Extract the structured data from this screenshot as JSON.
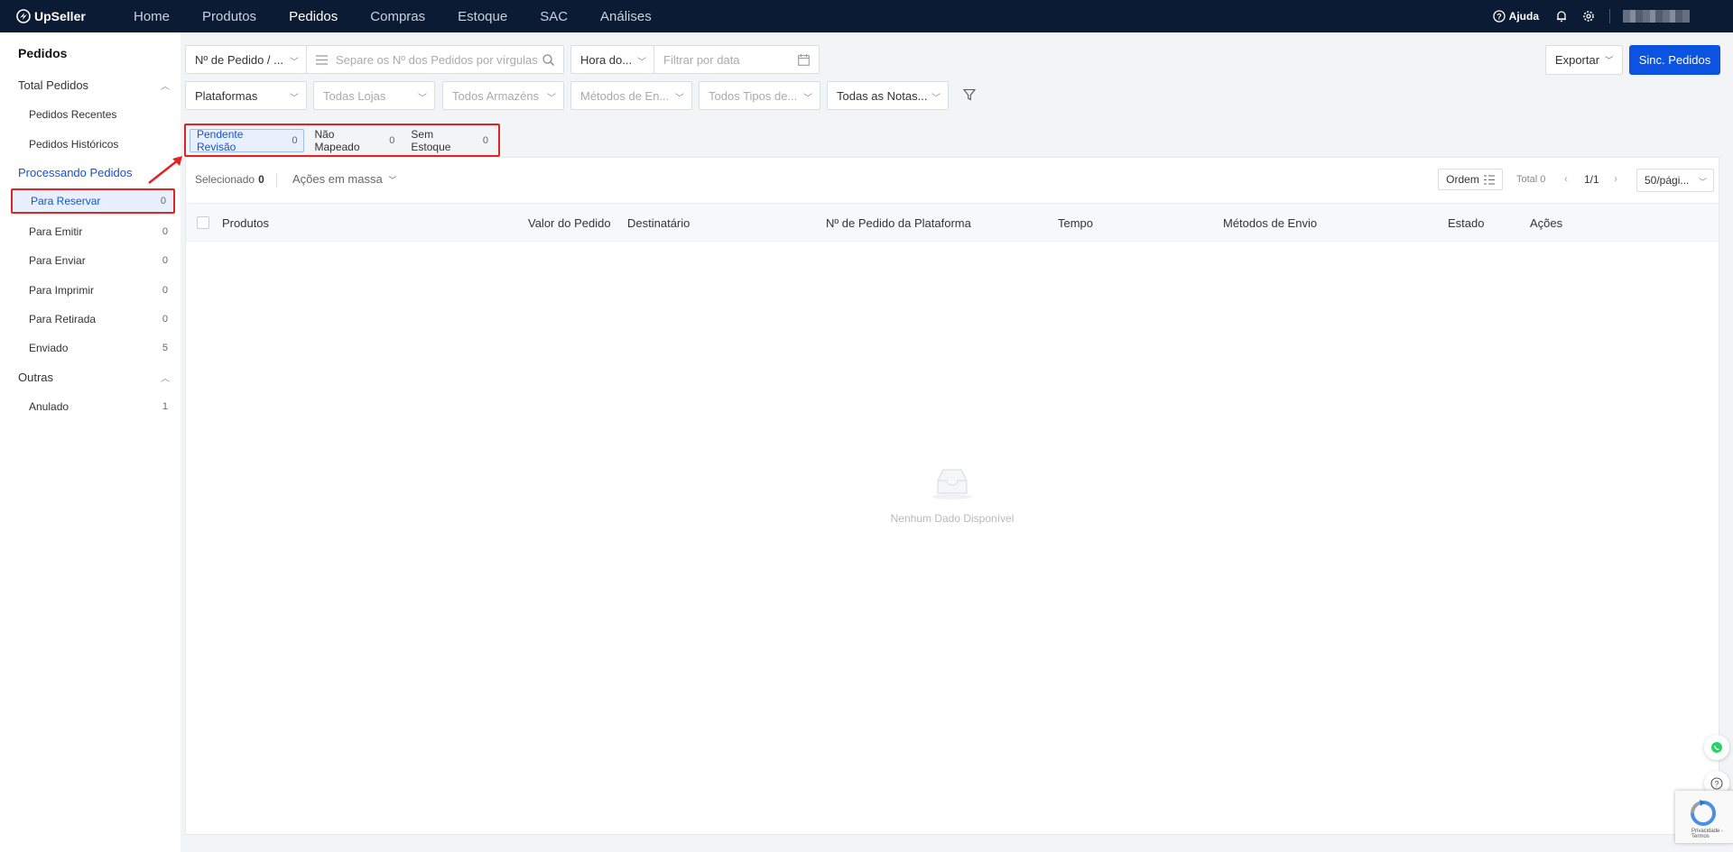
{
  "app": {
    "brand": "UpSeller"
  },
  "nav": {
    "items": [
      "Home",
      "Produtos",
      "Pedidos",
      "Compras",
      "Estoque",
      "SAC",
      "Análises"
    ],
    "active": "Pedidos",
    "help_label": "Ajuda"
  },
  "sidebar": {
    "title": "Pedidos",
    "group_total": "Total Pedidos",
    "recentes": "Pedidos Recentes",
    "historicos": "Pedidos Históricos",
    "group_processando": "Processando Pedidos",
    "processing_items": [
      {
        "label": "Para Reservar",
        "count": "0"
      },
      {
        "label": "Para Emitir",
        "count": "0"
      },
      {
        "label": "Para Enviar",
        "count": "0"
      },
      {
        "label": "Para Imprimir",
        "count": "0"
      },
      {
        "label": "Para Retirada",
        "count": "0"
      },
      {
        "label": "Enviado",
        "count": "5"
      }
    ],
    "group_outras": "Outras",
    "anulado": {
      "label": "Anulado",
      "count": "1"
    }
  },
  "filters": {
    "order_type": "Nº de Pedido / ...",
    "order_search_placeholder": "Separe os Nº dos Pedidos por vírgulas",
    "time_type": "Hora do...",
    "date_placeholder": "Filtrar por data",
    "platforms": "Plataformas",
    "stores": "Todas Lojas",
    "warehouses": "Todos Armazéns",
    "shipping_methods": "Métodos de En...",
    "order_types": "Todos Tipos de...",
    "notes": "Todas as Notas..."
  },
  "actions": {
    "export_label": "Exportar",
    "sync_label": "Sinc. Pedidos"
  },
  "tabs": [
    {
      "label": "Pendente Revisão",
      "count": "0"
    },
    {
      "label": "Não Mapeado",
      "count": "0"
    },
    {
      "label": "Sem Estoque",
      "count": "0"
    }
  ],
  "toolbar": {
    "selected_label": "Selecionado",
    "selected_count": "0",
    "bulk_actions": "Ações em massa",
    "order_label": "Ordem",
    "total_label": "Total 0",
    "page": "1/1",
    "per_page": "50/pági..."
  },
  "table": {
    "columns": [
      "Produtos",
      "Valor do Pedido",
      "Destinatário",
      "Nº de Pedido da Plataforma",
      "Tempo",
      "Métodos de Envio",
      "Estado",
      "Ações"
    ],
    "empty_text": "Nenhum Dado Disponível"
  },
  "recaptcha_text": "Privacidade - Termos",
  "colors": {
    "nav_bg": "#0b1b33",
    "primary": "#0b53e0",
    "highlight_border": "#e02424",
    "active_bg": "#e8f0fe"
  }
}
